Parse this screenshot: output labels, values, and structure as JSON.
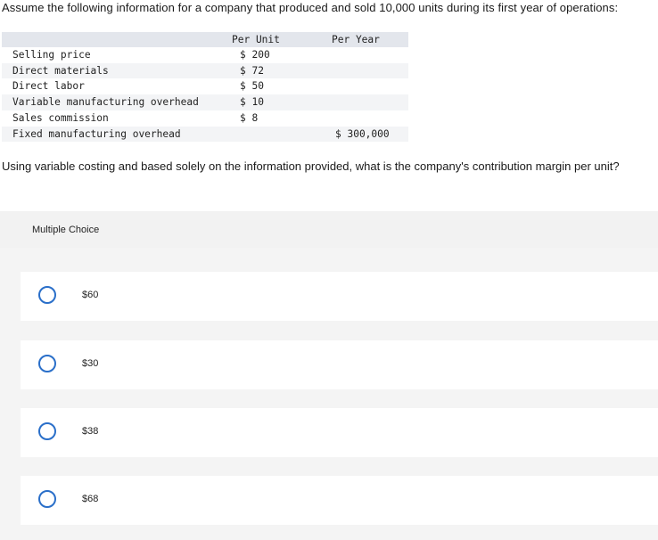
{
  "intro": "Assume the following information for a company that produced and sold 10,000 units during its first year of operations:",
  "table": {
    "headers": {
      "per_unit": "Per Unit",
      "per_year": "Per Year"
    },
    "rows": [
      {
        "label": "Selling price",
        "per_unit": "$ 200",
        "per_year": ""
      },
      {
        "label": "Direct materials",
        "per_unit": "$ 72",
        "per_year": ""
      },
      {
        "label": "Direct labor",
        "per_unit": "$ 50",
        "per_year": ""
      },
      {
        "label": "Variable manufacturing overhead",
        "per_unit": "$ 10",
        "per_year": ""
      },
      {
        "label": "Sales commission",
        "per_unit": "$ 8",
        "per_year": ""
      },
      {
        "label": "Fixed manufacturing overhead",
        "per_unit": "",
        "per_year": "$ 300,000"
      }
    ]
  },
  "question": "Using variable costing and based solely on the information provided, what is the company's contribution margin per unit?",
  "multiple_choice": {
    "title": "Multiple Choice",
    "options": [
      {
        "label": "$60"
      },
      {
        "label": "$30"
      },
      {
        "label": "$38"
      },
      {
        "label": "$68"
      }
    ]
  },
  "colors": {
    "radio_border": "#2a6fc9",
    "header_row_bg": "#e3e6ec",
    "panel_bg": "#f2f2f2"
  }
}
